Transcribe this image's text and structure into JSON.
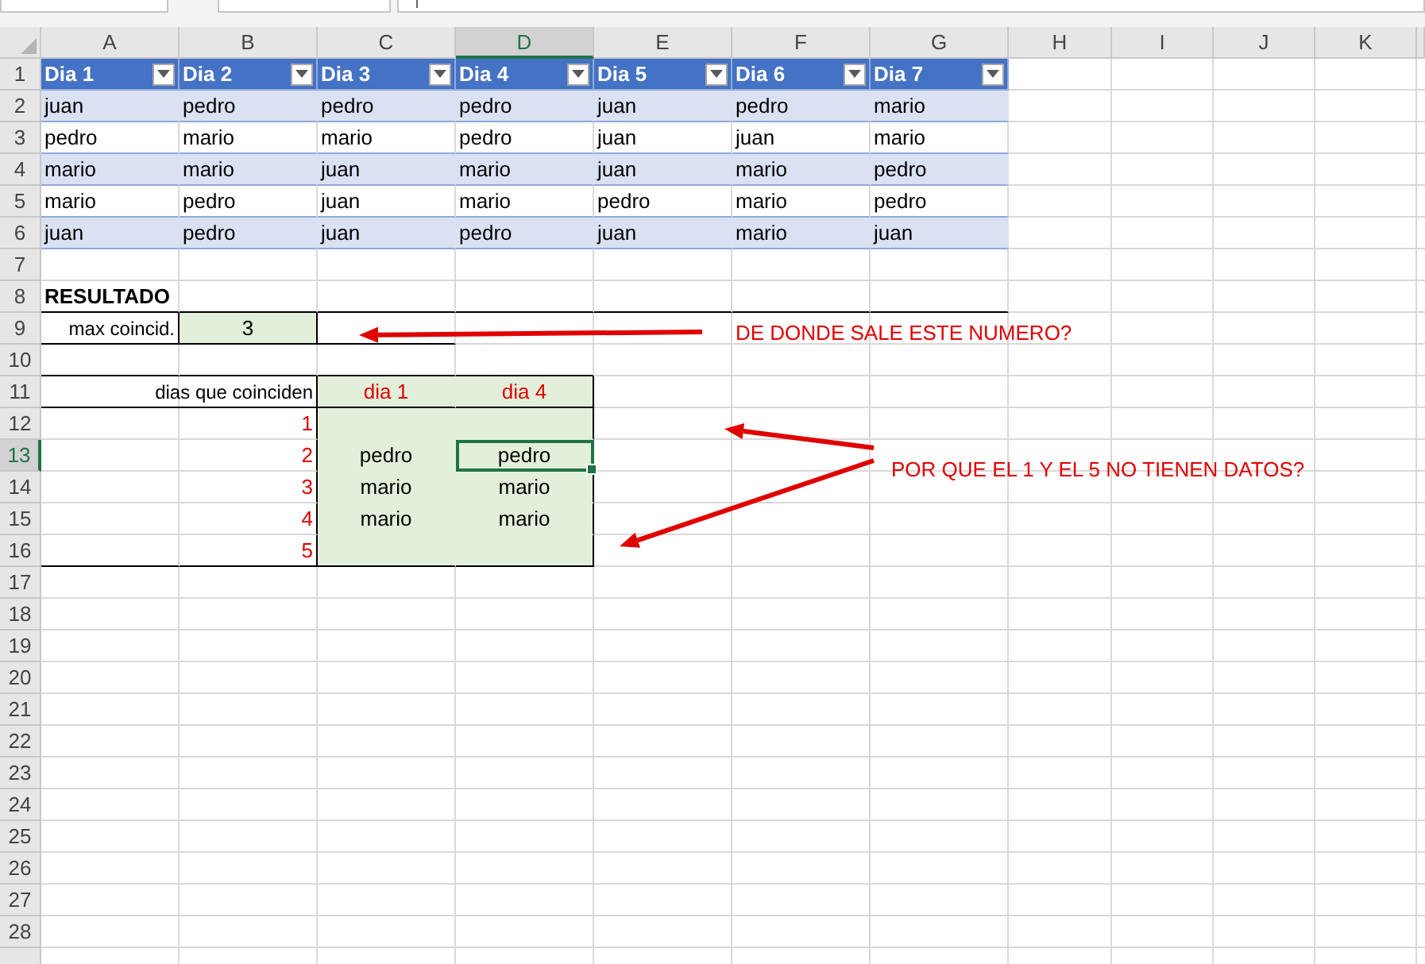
{
  "columns": [
    {
      "label": "A",
      "selected": false
    },
    {
      "label": "B",
      "selected": false
    },
    {
      "label": "C",
      "selected": false
    },
    {
      "label": "D",
      "selected": true
    },
    {
      "label": "E",
      "selected": false
    },
    {
      "label": "F",
      "selected": false
    },
    {
      "label": "G",
      "selected": false
    },
    {
      "label": "H",
      "selected": false
    },
    {
      "label": "I",
      "selected": false
    },
    {
      "label": "J",
      "selected": false
    },
    {
      "label": "K",
      "selected": false
    }
  ],
  "rows": [
    {
      "number": "1",
      "selected": false,
      "cells": [
        {
          "kind": "header",
          "text": "Dia 1"
        },
        {
          "kind": "header",
          "text": "Dia 2"
        },
        {
          "kind": "header",
          "text": "Dia 3"
        },
        {
          "kind": "header",
          "text": "Dia 4"
        },
        {
          "kind": "header",
          "text": "Dia 5"
        },
        {
          "kind": "header",
          "text": "Dia 6"
        },
        {
          "kind": "header",
          "text": "Dia 7"
        }
      ]
    },
    {
      "number": "2",
      "selected": false,
      "cells": [
        {
          "kind": "band",
          "text": "juan"
        },
        {
          "kind": "band",
          "text": "pedro"
        },
        {
          "kind": "band",
          "text": "pedro"
        },
        {
          "kind": "band",
          "text": "pedro"
        },
        {
          "kind": "band",
          "text": "juan"
        },
        {
          "kind": "band",
          "text": "pedro"
        },
        {
          "kind": "band",
          "text": "mario"
        }
      ]
    },
    {
      "number": "3",
      "selected": false,
      "cells": [
        {
          "kind": "plain",
          "text": "pedro"
        },
        {
          "kind": "plain",
          "text": "mario"
        },
        {
          "kind": "plain",
          "text": "mario"
        },
        {
          "kind": "plain",
          "text": "pedro"
        },
        {
          "kind": "plain",
          "text": "juan"
        },
        {
          "kind": "plain",
          "text": "juan"
        },
        {
          "kind": "plain",
          "text": "mario"
        }
      ]
    },
    {
      "number": "4",
      "selected": false,
      "cells": [
        {
          "kind": "band",
          "text": "mario"
        },
        {
          "kind": "band",
          "text": "mario"
        },
        {
          "kind": "band",
          "text": "juan"
        },
        {
          "kind": "band",
          "text": "mario"
        },
        {
          "kind": "band",
          "text": "juan"
        },
        {
          "kind": "band",
          "text": "mario"
        },
        {
          "kind": "band",
          "text": "pedro"
        }
      ]
    },
    {
      "number": "5",
      "selected": false,
      "cells": [
        {
          "kind": "plain",
          "text": "mario"
        },
        {
          "kind": "plain",
          "text": "pedro"
        },
        {
          "kind": "plain",
          "text": "juan"
        },
        {
          "kind": "plain",
          "text": "mario"
        },
        {
          "kind": "plain",
          "text": "pedro"
        },
        {
          "kind": "plain",
          "text": "mario"
        },
        {
          "kind": "plain",
          "text": "pedro"
        }
      ]
    },
    {
      "number": "6",
      "selected": false,
      "cells": [
        {
          "kind": "band",
          "text": "juan"
        },
        {
          "kind": "band",
          "text": "pedro"
        },
        {
          "kind": "band",
          "text": "juan"
        },
        {
          "kind": "band",
          "text": "pedro"
        },
        {
          "kind": "band",
          "text": "juan"
        },
        {
          "kind": "band",
          "text": "mario"
        },
        {
          "kind": "band",
          "text": "juan"
        }
      ]
    },
    {
      "number": "7",
      "selected": false
    },
    {
      "number": "8",
      "selected": false,
      "cells": [
        {
          "kind": "title",
          "text": "RESULTADO"
        }
      ]
    },
    {
      "number": "9",
      "selected": false,
      "cells": [
        {
          "kind": "label",
          "text": "max coincid."
        },
        {
          "kind": "value",
          "text": "3"
        }
      ]
    },
    {
      "number": "10",
      "selected": false
    },
    {
      "number": "11",
      "selected": false,
      "cells": [
        {},
        {
          "kind": "label",
          "text": "dias que coinciden"
        },
        {
          "kind": "green-header",
          "text": "dia 1"
        },
        {
          "kind": "green-header",
          "text": "dia 4"
        }
      ]
    },
    {
      "number": "12",
      "selected": false,
      "cells": [
        {},
        {
          "kind": "number",
          "text": "1"
        },
        {
          "kind": "green"
        },
        {
          "kind": "green"
        }
      ]
    },
    {
      "number": "13",
      "selected": true,
      "cells": [
        {},
        {
          "kind": "number",
          "text": "2"
        },
        {
          "kind": "green",
          "text": "pedro"
        },
        {
          "kind": "green",
          "text": "pedro"
        }
      ]
    },
    {
      "number": "14",
      "selected": false,
      "cells": [
        {},
        {
          "kind": "number",
          "text": "3"
        },
        {
          "kind": "green",
          "text": "mario"
        },
        {
          "kind": "green",
          "text": "mario"
        }
      ]
    },
    {
      "number": "15",
      "selected": false,
      "cells": [
        {},
        {
          "kind": "number",
          "text": "4"
        },
        {
          "kind": "green",
          "text": "mario"
        },
        {
          "kind": "green",
          "text": "mario"
        }
      ]
    },
    {
      "number": "16",
      "selected": false,
      "cells": [
        {},
        {
          "kind": "number",
          "text": "5"
        },
        {
          "kind": "green"
        },
        {
          "kind": "green"
        }
      ]
    },
    {
      "number": "17",
      "selected": false
    },
    {
      "number": "18",
      "selected": false
    },
    {
      "number": "19",
      "selected": false
    },
    {
      "number": "20",
      "selected": false
    },
    {
      "number": "21",
      "selected": false
    },
    {
      "number": "22",
      "selected": false
    },
    {
      "number": "23",
      "selected": false
    },
    {
      "number": "24",
      "selected": false
    },
    {
      "number": "25",
      "selected": false
    },
    {
      "number": "26",
      "selected": false
    },
    {
      "number": "27",
      "selected": false
    },
    {
      "number": "28",
      "selected": false
    }
  ],
  "annotations": [
    {
      "text": "DE DONDE SALE ESTE NUMERO?"
    },
    {
      "text": "POR QUE EL 1 Y EL 5 NO TIENEN DATOS?"
    }
  ]
}
